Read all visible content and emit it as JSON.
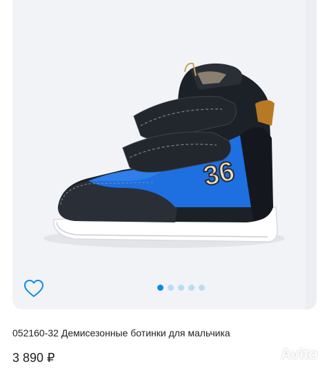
{
  "listing": {
    "title": "052160-32 Демисезонные ботинки для мальчика",
    "price": "3 890 ₽",
    "badge_number": "36"
  },
  "gallery": {
    "image_count": 5,
    "active_index": 0
  },
  "watermark": {
    "text": "Avito"
  },
  "icons": {
    "favorite": "heart-outline-icon"
  },
  "colors": {
    "accent": "#0a8be6",
    "dot_inactive": "#b9dcf6",
    "shoe_blue": "#1e6fe0",
    "shoe_dark": "#1c2128"
  }
}
